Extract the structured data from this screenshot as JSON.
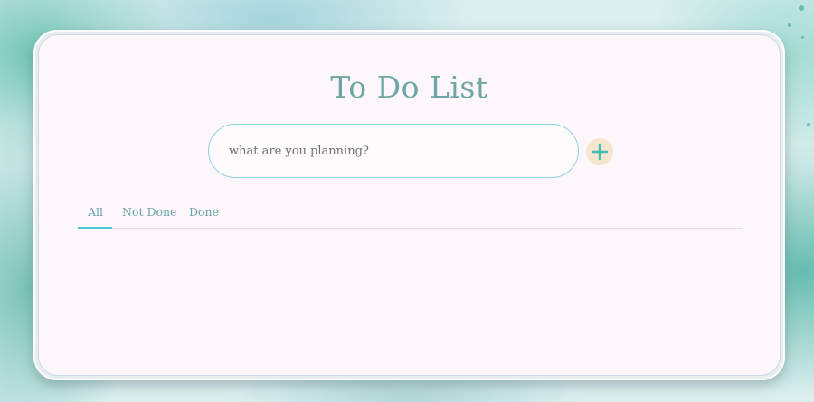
{
  "app": {
    "title": "To Do List"
  },
  "task_input": {
    "placeholder": "what are you planning?",
    "value": ""
  },
  "add_button": {
    "icon": "plus-icon",
    "icon_color": "#3cc0b4",
    "background_color": "#f6e5cf"
  },
  "tabs": [
    {
      "label": "All",
      "selected": true
    },
    {
      "label": "Not Done",
      "selected": false
    },
    {
      "label": "Done",
      "selected": false
    }
  ],
  "theme": {
    "title_color": "#6ea6a4",
    "accent_color": "#4cc6cf",
    "card_background": "#fdf6fb"
  }
}
